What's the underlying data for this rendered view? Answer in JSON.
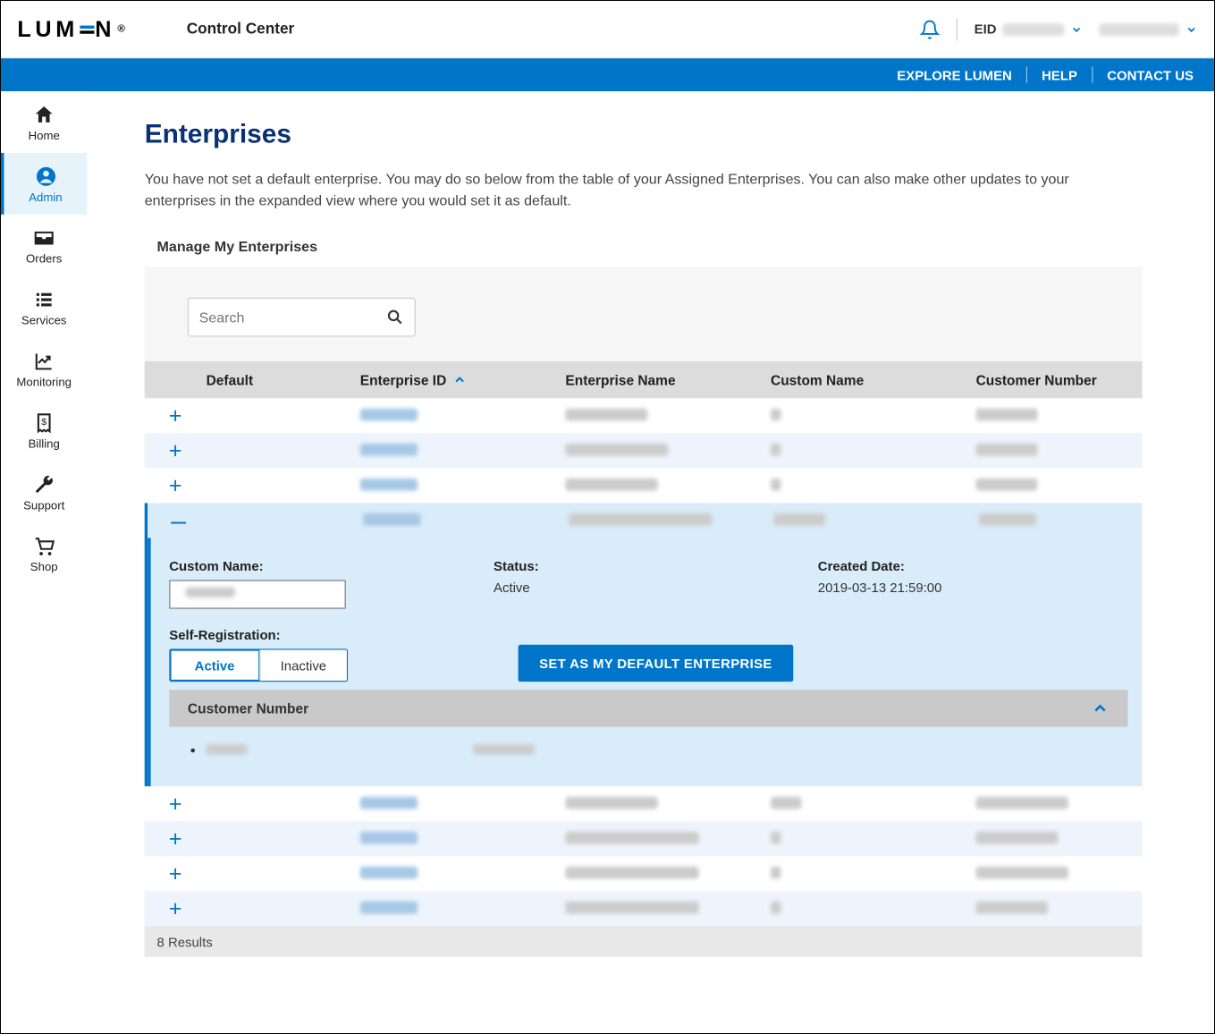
{
  "header": {
    "logo_text": "LUMEN",
    "app_name": "Control Center",
    "eid_label": "EID"
  },
  "bluebar": {
    "explore": "EXPLORE LUMEN",
    "help": "HELP",
    "contact": "CONTACT US"
  },
  "sidebar": {
    "items": [
      {
        "label": "Home"
      },
      {
        "label": "Admin"
      },
      {
        "label": "Orders"
      },
      {
        "label": "Services"
      },
      {
        "label": "Monitoring"
      },
      {
        "label": "Billing"
      },
      {
        "label": "Support"
      },
      {
        "label": "Shop"
      }
    ]
  },
  "page": {
    "title": "Enterprises",
    "description": "You have not set a default enterprise. You may do so below from the table of your Assigned Enterprises. You can also make other updates to your enterprises in the expanded view where you would set it as default.",
    "section_title": "Manage My Enterprises",
    "search_placeholder": "Search"
  },
  "table": {
    "columns": {
      "default": "Default",
      "enterprise_id": "Enterprise ID",
      "enterprise_name": "Enterprise Name",
      "custom_name": "Custom Name",
      "customer_number": "Customer Number"
    },
    "rows_before": 3,
    "rows_after": 4,
    "results_label": "8 Results"
  },
  "expanded": {
    "custom_name_label": "Custom Name:",
    "status_label": "Status:",
    "status_value": "Active",
    "created_label": "Created Date:",
    "created_value": "2019-03-13 21:59:00",
    "self_reg_label": "Self-Registration:",
    "seg_active": "Active",
    "seg_inactive": "Inactive",
    "set_default_btn": "SET AS MY DEFAULT ENTERPRISE",
    "customer_number_header": "Customer Number"
  }
}
